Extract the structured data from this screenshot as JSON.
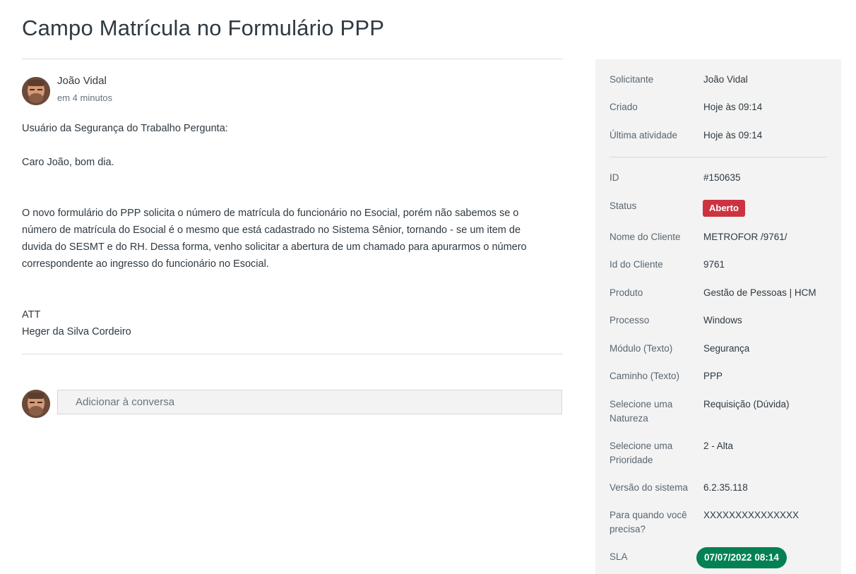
{
  "ticket": {
    "title": "Campo Matrícula no Formulário PPP"
  },
  "comment": {
    "author": "João Vidal",
    "time": "em 4 minutos",
    "paragraphs": [
      "Usuário da Segurança do Trabalho Pergunta:",
      "Caro João, bom dia.",
      "O novo formulário do PPP solicita o número de matrícula do funcionário no Esocial, porém não sabemos se o número de matrícula do Esocial é o mesmo que está cadastrado no Sistema Sênior, tornando - se um item de duvida do SESMT e do RH. Dessa forma, venho solicitar a abertura de um chamado para apurarmos o número correspondente ao ingresso do funcionário no Esocial.",
      "ATT",
      "Heger da Silva Cordeiro"
    ]
  },
  "reply": {
    "placeholder": "Adicionar à conversa"
  },
  "sidebar": {
    "requester_label": "Solicitante",
    "requester_value": "João Vidal",
    "created_label": "Criado",
    "created_value": "Hoje às 09:14",
    "last_activity_label": "Última atividade",
    "last_activity_value": "Hoje às 09:14",
    "id_label": "ID",
    "id_value": "#150635",
    "status_label": "Status",
    "status_value": "Aberto",
    "client_name_label": "Nome do Cliente",
    "client_name_value": "METROFOR /9761/",
    "client_id_label": "Id do Cliente",
    "client_id_value": "9761",
    "product_label": "Produto",
    "product_value": "Gestão de Pessoas | HCM",
    "process_label": "Processo",
    "process_value": "Windows",
    "module_label": "Módulo (Texto)",
    "module_value": "Segurança",
    "path_label": "Caminho (Texto)",
    "path_value": "PPP",
    "nature_label": "Selecione uma Natureza",
    "nature_value": "Requisição (Dúvida)",
    "priority_label": "Selecione uma Prioridade",
    "priority_value": "2 - Alta",
    "version_label": "Versão do sistema",
    "version_value": "6.2.35.118",
    "needed_label": "Para quando você precisa?",
    "needed_value": "XXXXXXXXXXXXXXX",
    "sla_label": "SLA",
    "sla_value": "07/07/2022 08:14"
  },
  "colors": {
    "status_open": "#cc3340",
    "sla_ok": "#038153",
    "sidebar_bg": "#f3f3f3"
  }
}
